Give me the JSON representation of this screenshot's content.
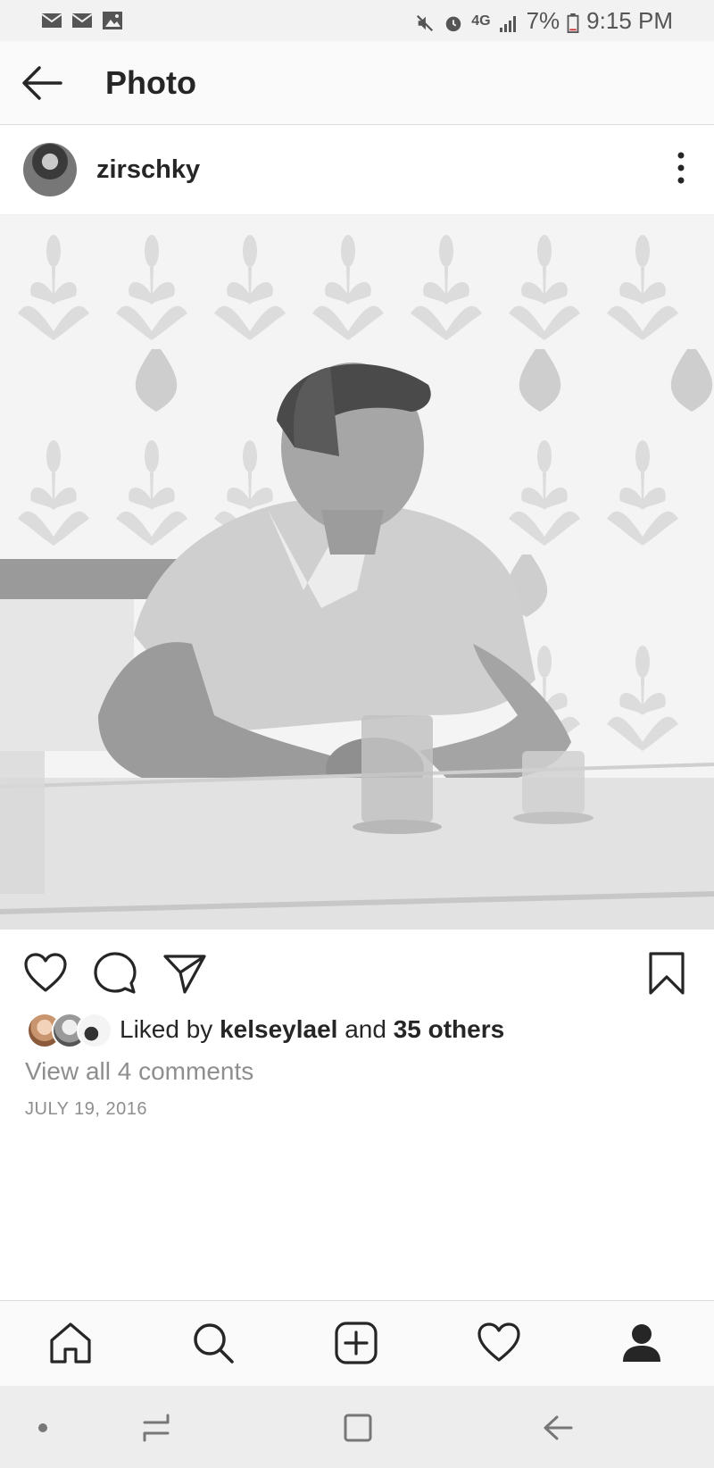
{
  "status_bar": {
    "left_icons": [
      "mail-icon",
      "mail-icon",
      "gallery-icon"
    ],
    "network": "4G",
    "battery": "7%",
    "time": "9:15 PM"
  },
  "header": {
    "title": "Photo",
    "back_icon": "back-arrow-icon"
  },
  "post": {
    "username": "zirschky",
    "liked_by_prefix": "Liked by ",
    "liked_by_user": "kelseylael",
    "liked_by_middle": " and ",
    "liked_by_others": "35 others",
    "view_comments": "View all 4 comments",
    "date": "JULY 19, 2016"
  },
  "actions": [
    "heart-icon",
    "comment-icon",
    "share-icon",
    "bookmark-icon"
  ],
  "bottom_nav": {
    "items": [
      "home-icon",
      "search-icon",
      "add-icon",
      "activity-heart-icon",
      "profile-icon"
    ],
    "active": "profile-icon"
  },
  "system_nav": [
    "dot-icon",
    "recents-icon",
    "home-square-icon",
    "back-icon"
  ],
  "colors": {
    "text": "#262626",
    "muted": "#8e8e8e",
    "border": "#dbdbdb"
  }
}
